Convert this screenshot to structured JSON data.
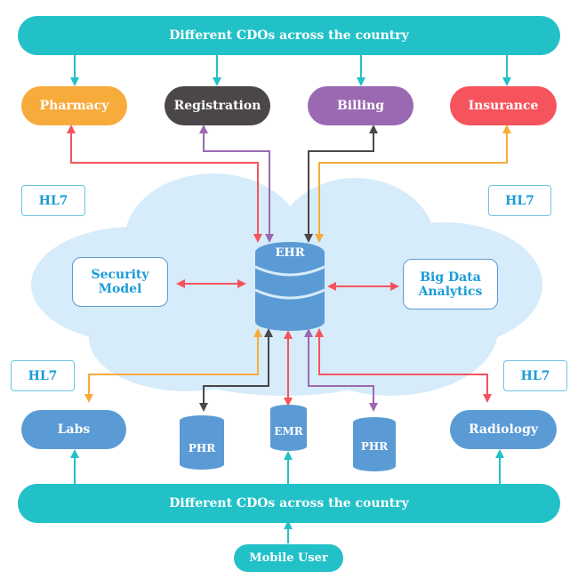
{
  "top_bar": {
    "label": "Different CDOs across the country"
  },
  "bottom_bar": {
    "label": "Different CDOs across the country"
  },
  "top_nodes": [
    {
      "label": "Pharmacy",
      "color": "#f7ab3b"
    },
    {
      "label": "Registration",
      "color": "#4a4649"
    },
    {
      "label": "Billing",
      "color": "#9b69b1"
    },
    {
      "label": "Insurance",
      "color": "#f5545c"
    }
  ],
  "hl7": [
    "HL7",
    "HL7",
    "HL7",
    "HL7"
  ],
  "security": "Security Model",
  "bigdata": "Big Data Analytics",
  "ehr": "EHR",
  "stores": [
    "PHR",
    "EMR",
    "PHR"
  ],
  "labs": "Labs",
  "radiology": "Radiology",
  "mobile": "Mobile User",
  "colors": {
    "teal": "#22c1c8",
    "blue": "#5b9bd5",
    "cloud": "#d6ecfa",
    "red": "#f5545c",
    "orange": "#f7ab3b",
    "dark": "#4a4649",
    "purple": "#9b69b1"
  }
}
